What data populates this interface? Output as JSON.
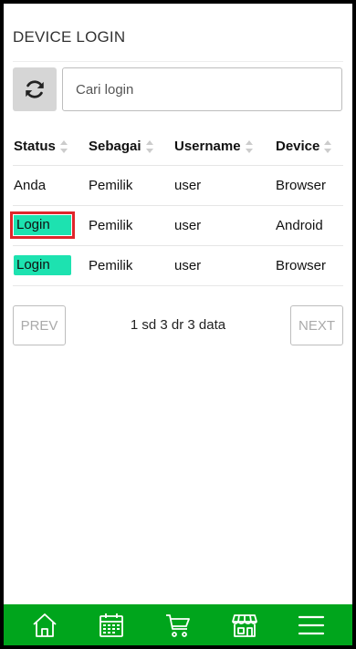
{
  "page": {
    "title": "DEVICE LOGIN"
  },
  "search": {
    "placeholder": "Cari login",
    "value": ""
  },
  "table": {
    "columns": [
      "Status",
      "Sebagai",
      "Username",
      "Device"
    ],
    "rows": [
      {
        "status": "Anda",
        "status_badge": false,
        "sebagai": "Pemilik",
        "username": "user",
        "device": "Browser"
      },
      {
        "status": "Login",
        "status_badge": true,
        "selected": true,
        "sebagai": "Pemilik",
        "username": "user",
        "device": "Android"
      },
      {
        "status": "Login",
        "status_badge": true,
        "sebagai": "Pemilik",
        "username": "user",
        "device": "Browser"
      }
    ]
  },
  "pagination": {
    "prev_label": "PREV",
    "next_label": "NEXT",
    "info": "1 sd 3 dr 3 data"
  },
  "bottom_nav": {
    "items": [
      {
        "icon": "home-icon"
      },
      {
        "icon": "calendar-icon"
      },
      {
        "icon": "cart-icon"
      },
      {
        "icon": "store-icon"
      },
      {
        "icon": "menu-icon"
      }
    ]
  },
  "colors": {
    "accent": "#00a51c",
    "badge": "#1de2b0",
    "selection": "#e0262b"
  }
}
